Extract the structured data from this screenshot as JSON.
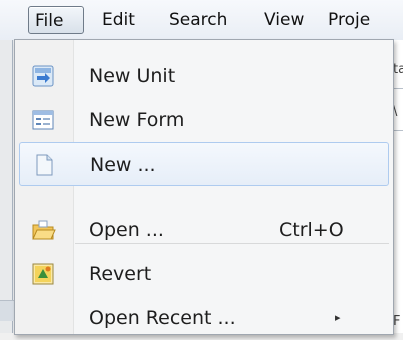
{
  "menubar": {
    "items": [
      "File",
      "Edit",
      "Search",
      "View",
      "Proje"
    ]
  },
  "background": {
    "fragments": [
      "ta",
      "\\",
      "F"
    ]
  },
  "file_menu": {
    "items": [
      {
        "label": "New Unit",
        "icon": "new-unit-icon"
      },
      {
        "label": "New Form",
        "icon": "new-form-icon"
      },
      {
        "label": "New ...",
        "icon": "new-file-icon"
      },
      {
        "label": "Open ...",
        "shortcut": "Ctrl+O",
        "icon": "open-folder-icon"
      },
      {
        "label": "Revert",
        "icon": "revert-icon"
      },
      {
        "label": "Open Recent ...",
        "submenu": true,
        "arrow": "▸"
      }
    ],
    "hovered_item": "New ..."
  }
}
